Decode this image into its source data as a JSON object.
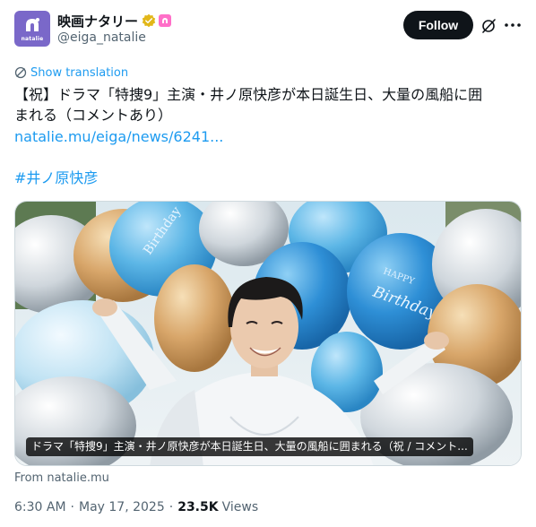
{
  "account": {
    "display_name": "映画ナタリー",
    "handle": "@eiga_natalie",
    "avatar_text": "natalie"
  },
  "follow_label": "Follow",
  "translate_label": "Show translation",
  "tweet": {
    "line1": "【祝】ドラマ「特捜9」主演・井ノ原快彦が本日誕生日、大量の風船に囲",
    "line2": "まれる（コメントあり）",
    "link": "natalie.mu/eiga/news/6241...",
    "hashtag": "#井ノ原快彦"
  },
  "media": {
    "caption": "ドラマ「特捜9」主演・井ノ原快彦が本日誕生日、大量の風船に囲まれる（祝 / コメント...",
    "balloon_text": "HAPPY Birthday"
  },
  "source": "From natalie.mu",
  "meta": {
    "time": "6:30 AM",
    "date": "May 17, 2025",
    "views_count": "23.5K",
    "views_label": "Views"
  },
  "colors": {
    "accent": "#1d9bf0",
    "avatar_bg": "#7a68c9",
    "verified": "#e2b719"
  },
  "icons": [
    "natalie-logo-icon",
    "verified-badge-icon",
    "affiliate-badge-icon",
    "grok-icon",
    "more-icon",
    "translate-icon"
  ]
}
